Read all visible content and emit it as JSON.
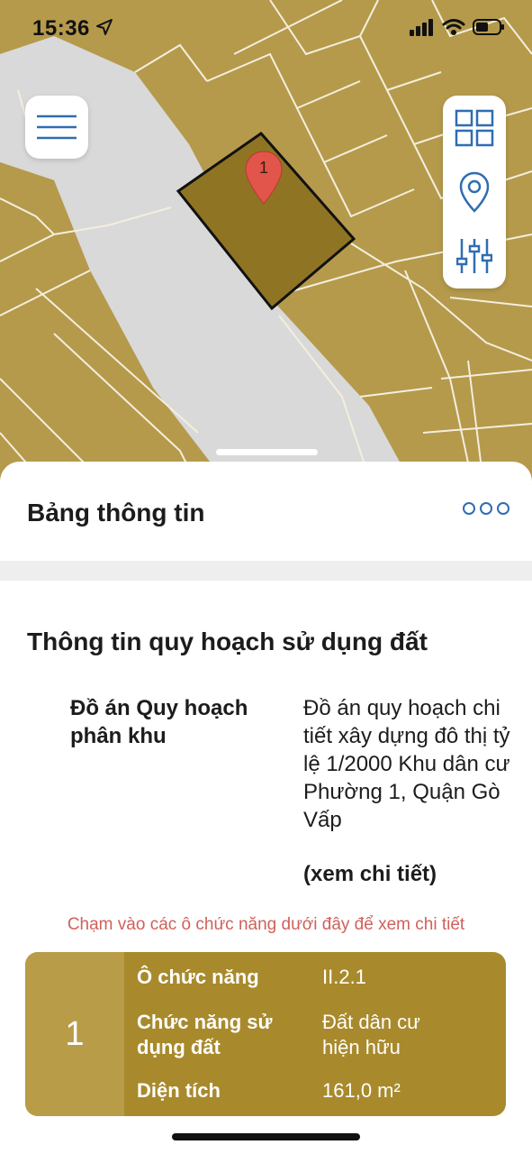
{
  "status_bar": {
    "time": "15:36",
    "icons": [
      "location-arrow-icon",
      "signal-icon",
      "wifi-icon",
      "battery-icon"
    ]
  },
  "map": {
    "colors": {
      "parcel_fill": "#b59a4c",
      "road": "#d9d9d9",
      "highlight": "#8f7424",
      "marker": "#e2554a"
    },
    "marker_label": "1",
    "controls": [
      "menu-icon",
      "grid-icon",
      "location-pin-icon",
      "sliders-icon"
    ]
  },
  "panel": {
    "title": "Bảng thông tin",
    "more_icon": "more-dots-icon"
  },
  "planning": {
    "section_title": "Thông tin quy hoạch sử dụng đất",
    "label": "Đồ án Quy hoạch phân khu",
    "value": "Đồ án quy hoạch chi tiết xây dựng đô thị tỷ lệ 1/2000 Khu dân cư Phường 1, Quận Gò Vấp",
    "detail_link": "(xem chi tiết)"
  },
  "hint": "Chạm vào các ô chức năng dưới đây để xem chi tiết",
  "lot_card": {
    "number": "1",
    "rows": [
      {
        "label": "Ô chức năng",
        "value": "II.2.1"
      },
      {
        "label": "Chức năng sử dụng đất",
        "value": "Đất dân cư hiện hữu"
      },
      {
        "label": "Diện tích",
        "value": "161,0 m²"
      }
    ],
    "colors": {
      "card_bg": "#a88a2d",
      "number_bg": "#b99c48"
    }
  }
}
